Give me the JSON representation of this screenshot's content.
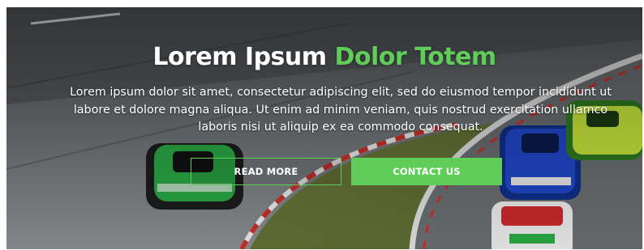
{
  "hero": {
    "title_main": "Lorem Ipsum ",
    "title_accent": "Dolor Totem",
    "paragraph_lines": [
      "Lorem ipsum dolor sit amet, consectetur adipiscing elit, sed do eiusmod tempor incididunt ut",
      "labore et dolore magna aliqua. Ut enim ad minim veniam, quis nostrud exercitation ullamco",
      "laboris nisi ut aliquip ex ea commodo consequat."
    ],
    "read_more_label": "READ MORE",
    "contact_us_label": "CONTACT US",
    "background_image": "race-cars-on-track-photo"
  },
  "colors": {
    "accent": "#5fcd58",
    "text": "#ffffff"
  }
}
